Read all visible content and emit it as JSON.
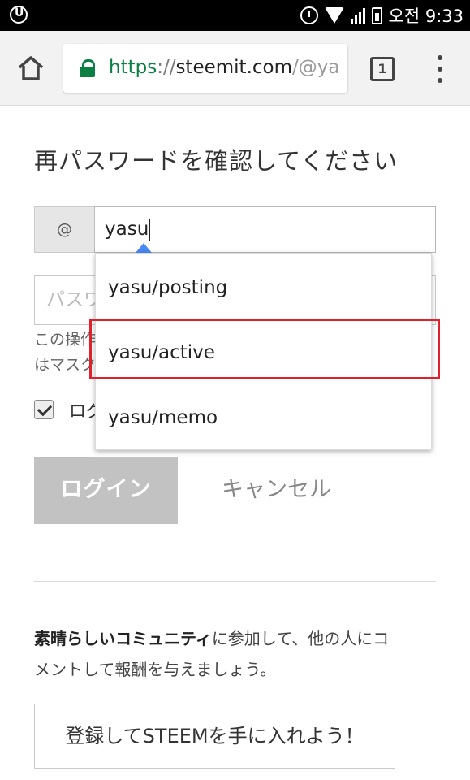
{
  "status_bar": {
    "time": "오전 9:33"
  },
  "browser": {
    "url_scheme": "https",
    "url_separator": "://",
    "url_host": "steemit.com",
    "url_path": "/@ya",
    "tab_count": "1"
  },
  "form": {
    "title": "再パスワードを確認してください",
    "at_prefix": "@",
    "username_value": "yasu",
    "password_placeholder": "パスワ",
    "note_line1": "この操作",
    "note_line2": "はマスク",
    "keep_logged_in_label": "ログ",
    "login_label": "ログイン",
    "cancel_label": "キャンセル"
  },
  "autocomplete": {
    "items": [
      "yasu/posting",
      "yasu/active",
      "yasu/memo"
    ],
    "highlighted_index": 1,
    "highlight_color": "#e2202c",
    "arrow_color": "#4a8af4"
  },
  "join": {
    "bold_text": "素晴らしいコミュニティ",
    "text_rest": "に参加して、他の人にコ",
    "line2": "メントして報酬を与えましょう。",
    "signup_label": "登録してSTEEMを手に入れよう！"
  },
  "colors": {
    "secure_green": "#0b8043",
    "button_disabled": "#c2c2c2"
  }
}
